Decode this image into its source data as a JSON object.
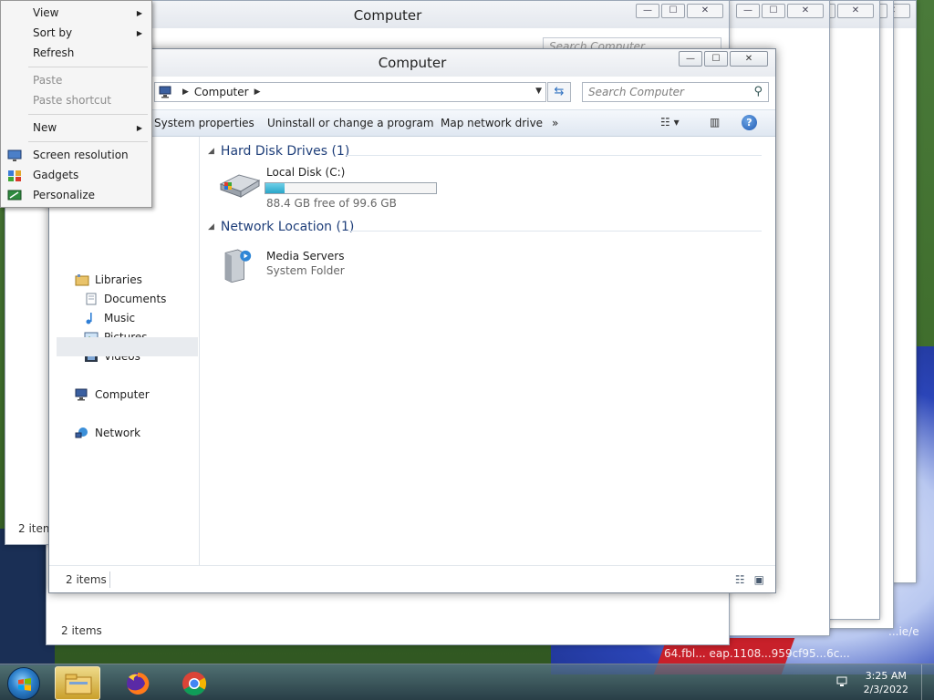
{
  "window": {
    "title": "Computer",
    "minimize_glyph": "—",
    "maximize_glyph": "☐",
    "close_glyph": "✕"
  },
  "address": {
    "location": "Computer",
    "search_placeholder": "Search Computer"
  },
  "toolbar": {
    "items": [
      "System properties",
      "Uninstall or change a program",
      "Map network drive"
    ],
    "overflow": "»",
    "help": "?"
  },
  "nav": {
    "libraries": "Libraries",
    "documents": "Documents",
    "music": "Music",
    "pictures": "Pictures",
    "videos": "Videos",
    "computer": "Computer",
    "network": "Network"
  },
  "content": {
    "group_drives": "Hard Disk Drives (1)",
    "drive_name": "Local Disk (C:)",
    "drive_space": "88.4 GB free of 99.6 GB",
    "drive_used_fraction": 0.11,
    "group_network": "Network Location (1)",
    "netloc_name": "Media Servers",
    "netloc_type": "System Folder"
  },
  "status": {
    "items_count": "2 items"
  },
  "context_menu": {
    "view": "View",
    "sort_by": "Sort by",
    "refresh": "Refresh",
    "paste": "Paste",
    "paste_shortcut": "Paste shortcut",
    "new": "New",
    "screen_resolution": "Screen resolution",
    "gadgets": "Gadgets",
    "personalize": "Personalize"
  },
  "ghost_windows": {
    "title": "Computer",
    "search_placeholder": "Search Computer",
    "status_text": "2 items",
    "partial_status": "2 item"
  },
  "taskbar": {
    "time": "3:25 AM",
    "date": "2/3/2022"
  },
  "desktop": {
    "filename_fragment": "64.fbl... eap.1108...959cf95...6c...",
    "partial_text": "...ie/e"
  },
  "colors": {
    "accent": "#1f3f7a",
    "progress": "#2aa6c9",
    "taskbar": "#2f4b5e"
  }
}
